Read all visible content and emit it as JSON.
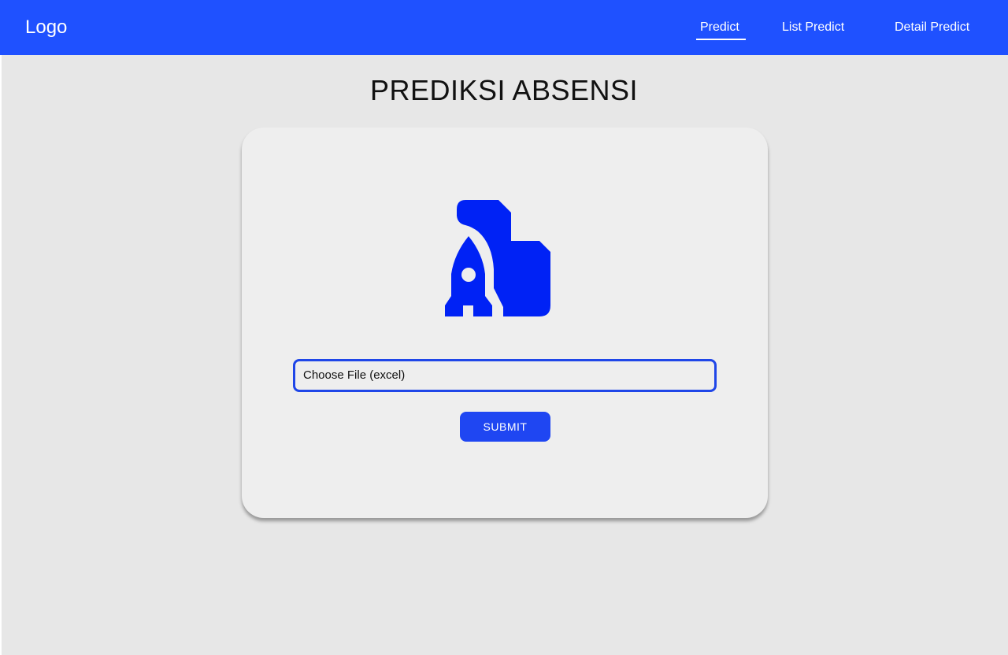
{
  "navbar": {
    "logo": "Logo",
    "links": [
      {
        "label": "Predict",
        "active": true
      },
      {
        "label": "List Predict",
        "active": false
      },
      {
        "label": "Detail Predict",
        "active": false
      }
    ]
  },
  "main": {
    "title": "PREDIKSI ABSENSI",
    "icon": "rocket-file-icon",
    "file_input": {
      "label": "Choose File (excel)"
    },
    "submit_label": "SUBMIT"
  },
  "colors": {
    "navbar": "#1f51ff",
    "accent": "#1f46f2",
    "icon": "#0022f5",
    "background": "#e7e7e7",
    "card": "#eeeeee"
  }
}
